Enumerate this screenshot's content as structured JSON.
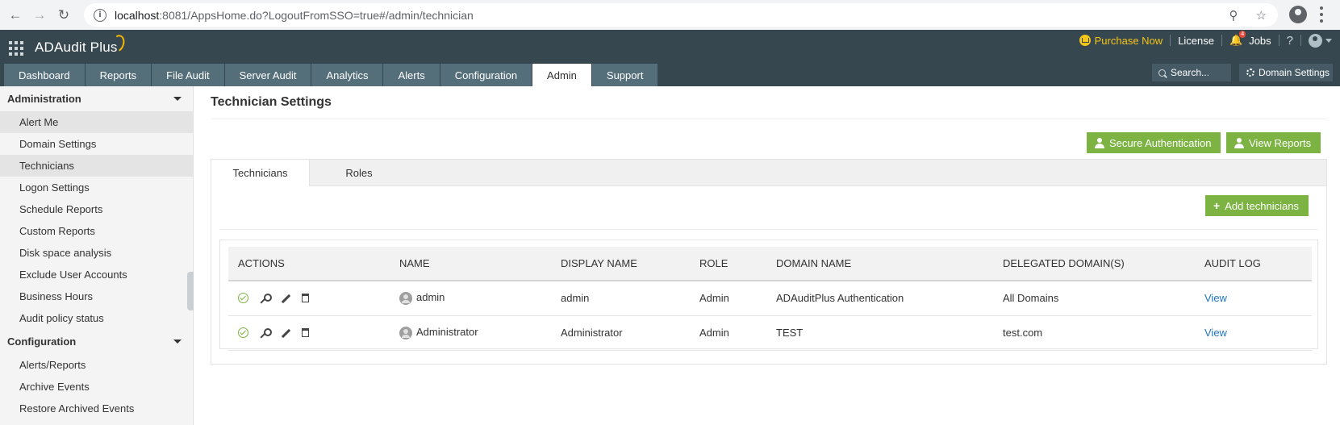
{
  "browser": {
    "url_host": "localhost",
    "url_path": ":8081/AppsHome.do?LogoutFromSSO=true#/admin/technician"
  },
  "app": {
    "logo": "ADAudit Plus",
    "purchase_now": "Purchase Now",
    "license": "License",
    "notification_count": "4",
    "jobs": "Jobs",
    "help": "?",
    "search_placeholder": "Search...",
    "domain_settings": "Domain Settings"
  },
  "nav": {
    "tabs": [
      "Dashboard",
      "Reports",
      "File Audit",
      "Server Audit",
      "Analytics",
      "Alerts",
      "Configuration",
      "Admin",
      "Support"
    ],
    "active": "Admin"
  },
  "sidebar": {
    "administration_title": "Administration",
    "administration_items": [
      "Alert Me",
      "Domain Settings",
      "Technicians",
      "Logon Settings",
      "Schedule Reports",
      "Custom Reports",
      "Disk space analysis",
      "Exclude User Accounts",
      "Business Hours",
      "Audit policy status"
    ],
    "configuration_title": "Configuration",
    "configuration_items": [
      "Alerts/Reports",
      "Archive Events",
      "Restore Archived Events"
    ]
  },
  "page": {
    "title": "Technician Settings",
    "secure_auth": "Secure Authentication",
    "view_reports": "View Reports",
    "tabs": [
      "Technicians",
      "Roles"
    ],
    "add_technicians": "Add technicians"
  },
  "table": {
    "headers": [
      "ACTIONS",
      "NAME",
      "DISPLAY NAME",
      "ROLE",
      "DOMAIN NAME",
      "DELEGATED DOMAIN(S)",
      "AUDIT LOG"
    ],
    "rows": [
      {
        "name": "admin",
        "display_name": "admin",
        "role": "Admin",
        "domain": "ADAuditPlus Authentication",
        "delegated": "All Domains",
        "audit": "View"
      },
      {
        "name": "Administrator",
        "display_name": "Administrator",
        "role": "Admin",
        "domain": "TEST",
        "delegated": "test.com",
        "audit": "View"
      }
    ]
  },
  "colors": {
    "header_bg": "#37474f",
    "tab_bg": "#546e7a",
    "accent_green": "#7cb342",
    "link_blue": "#1f76c2",
    "purchase_yellow": "#f5c518"
  }
}
